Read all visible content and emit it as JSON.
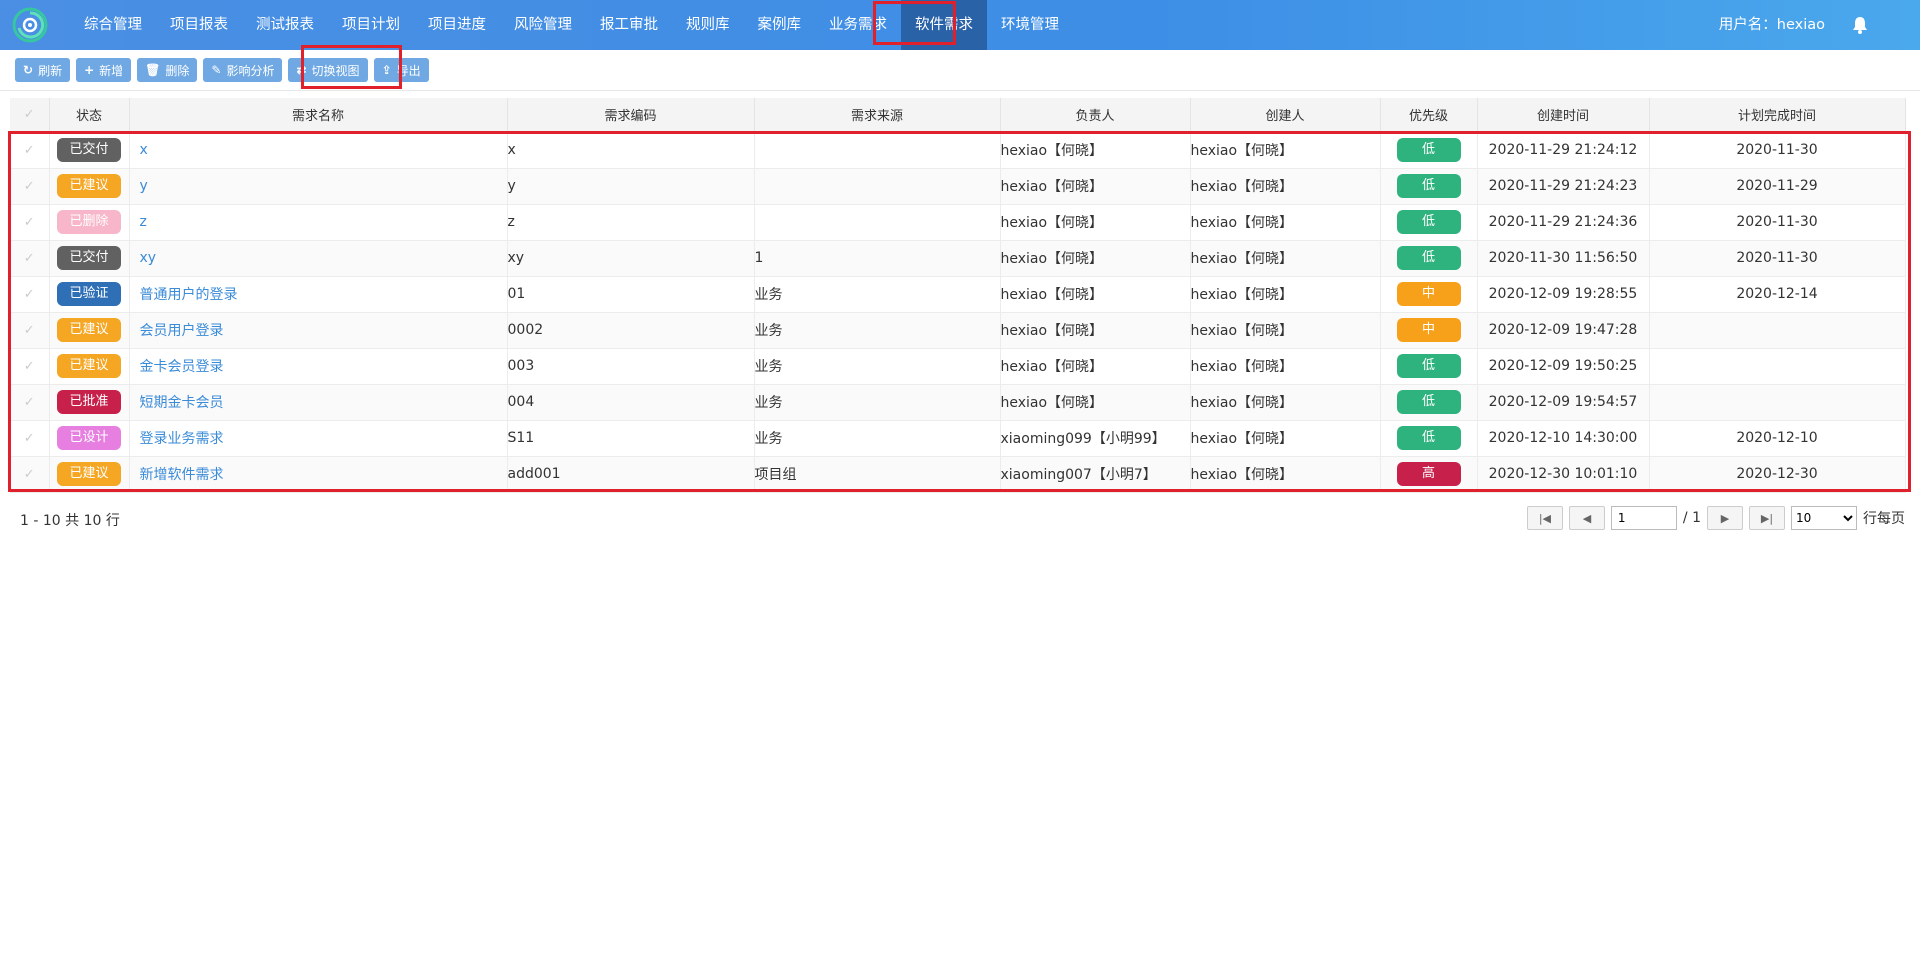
{
  "nav": {
    "items": [
      "综合管理",
      "项目报表",
      "测试报表",
      "项目计划",
      "项目进度",
      "风险管理",
      "报工审批",
      "规则库",
      "案例库",
      "业务需求",
      "软件需求",
      "环境管理"
    ],
    "active_index": 10,
    "user_label": "用户名：hexiao"
  },
  "toolbar": {
    "buttons": [
      {
        "icon": "↻",
        "label": "刷新"
      },
      {
        "icon": "+",
        "label": "新增"
      },
      {
        "icon": "🗑",
        "label": "删除"
      },
      {
        "icon": "✎",
        "label": "影响分析"
      },
      {
        "icon": "⇄",
        "label": "切换视图"
      },
      {
        "icon": "⇪",
        "label": "导出"
      }
    ]
  },
  "table": {
    "columns": [
      "",
      "状态",
      "需求名称",
      "需求编码",
      "需求来源",
      "负责人",
      "创建人",
      "优先级",
      "创建时间",
      "计划完成时间"
    ],
    "rows": [
      {
        "status": "已交付",
        "status_color": "#616161",
        "name": "x",
        "code": "x",
        "source": "",
        "owner": "hexiao【何晓】",
        "creator": "hexiao【何晓】",
        "priority": "低",
        "priority_color": "#2fb37e",
        "created": "2020-11-29 21:24:12",
        "planned": "2020-11-30"
      },
      {
        "status": "已建议",
        "status_color": "#f5a623",
        "name": "y",
        "code": "y",
        "source": "",
        "owner": "hexiao【何晓】",
        "creator": "hexiao【何晓】",
        "priority": "低",
        "priority_color": "#2fb37e",
        "created": "2020-11-29 21:24:23",
        "planned": "2020-11-29"
      },
      {
        "status": "已删除",
        "status_color": "#f7b6c9",
        "name": "z",
        "code": "z",
        "source": "",
        "owner": "hexiao【何晓】",
        "creator": "hexiao【何晓】",
        "priority": "低",
        "priority_color": "#2fb37e",
        "created": "2020-11-29 21:24:36",
        "planned": "2020-11-30"
      },
      {
        "status": "已交付",
        "status_color": "#616161",
        "name": "xy",
        "code": "xy",
        "source": "1",
        "owner": "hexiao【何晓】",
        "creator": "hexiao【何晓】",
        "priority": "低",
        "priority_color": "#2fb37e",
        "created": "2020-11-30 11:56:50",
        "planned": "2020-11-30"
      },
      {
        "status": "已验证",
        "status_color": "#2f6fb5",
        "name": "普通用户的登录",
        "code": "01",
        "source": "业务",
        "owner": "hexiao【何晓】",
        "creator": "hexiao【何晓】",
        "priority": "中",
        "priority_color": "#f7a01a",
        "created": "2020-12-09 19:28:55",
        "planned": "2020-12-14"
      },
      {
        "status": "已建议",
        "status_color": "#f5a623",
        "name": "会员用户登录",
        "code": "0002",
        "source": "业务",
        "owner": "hexiao【何晓】",
        "creator": "hexiao【何晓】",
        "priority": "中",
        "priority_color": "#f7a01a",
        "created": "2020-12-09 19:47:28",
        "planned": ""
      },
      {
        "status": "已建议",
        "status_color": "#f5a623",
        "name": "金卡会员登录",
        "code": "003",
        "source": "业务",
        "owner": "hexiao【何晓】",
        "creator": "hexiao【何晓】",
        "priority": "低",
        "priority_color": "#2fb37e",
        "created": "2020-12-09 19:50:25",
        "planned": ""
      },
      {
        "status": "已批准",
        "status_color": "#c7204b",
        "name": "短期金卡会员",
        "code": "004",
        "source": "业务",
        "owner": "hexiao【何晓】",
        "creator": "hexiao【何晓】",
        "priority": "低",
        "priority_color": "#2fb37e",
        "created": "2020-12-09 19:54:57",
        "planned": ""
      },
      {
        "status": "已设计",
        "status_color": "#e77fe0",
        "name": "登录业务需求",
        "code": "S11",
        "source": "业务",
        "owner": "xiaoming099【小明99】",
        "creator": "hexiao【何晓】",
        "priority": "低",
        "priority_color": "#2fb37e",
        "created": "2020-12-10 14:30:00",
        "planned": "2020-12-10"
      },
      {
        "status": "已建议",
        "status_color": "#f5a623",
        "name": "新增软件需求",
        "code": "add001",
        "source": "项目组",
        "owner": "xiaoming007【小明7】",
        "creator": "hexiao【何晓】",
        "priority": "高",
        "priority_color": "#c7204b",
        "created": "2020-12-30 10:01:10",
        "planned": "2020-12-30"
      }
    ]
  },
  "footer": {
    "summary": "1 - 10 共 10 行",
    "page_value": "1",
    "page_total": "/ 1",
    "page_size": "10",
    "page_size_label": "行每页"
  },
  "icons": {
    "logo": "swirl-logo-icon",
    "bell": "bell-icon",
    "first": "first-page-icon",
    "prev": "prev-page-icon",
    "next": "next-page-icon",
    "last": "last-page-icon"
  }
}
